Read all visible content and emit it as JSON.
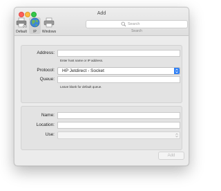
{
  "window": {
    "title": "Add"
  },
  "toolbar": {
    "default_label": "Default",
    "ip_label": "IP",
    "windows_label": "Windows",
    "search": {
      "placeholder": "Search",
      "label": "Search"
    }
  },
  "form": {
    "address": {
      "label": "Address:",
      "value": "",
      "hint": "Enter host name or IP address."
    },
    "protocol": {
      "label": "Protocol:",
      "value": "HP Jetdirect - Socket"
    },
    "queue": {
      "label": "Queue:",
      "value": "",
      "hint": "Leave blank for default queue."
    },
    "name": {
      "label": "Name:",
      "value": ""
    },
    "location": {
      "label": "Location:",
      "value": ""
    },
    "use": {
      "label": "Use:",
      "value": ""
    }
  },
  "buttons": {
    "add": "Add"
  },
  "colors": {
    "accent": "#2f7ff4",
    "close": "#fc605b",
    "minimize": "#fdbc40",
    "maximize": "#34c84a"
  }
}
